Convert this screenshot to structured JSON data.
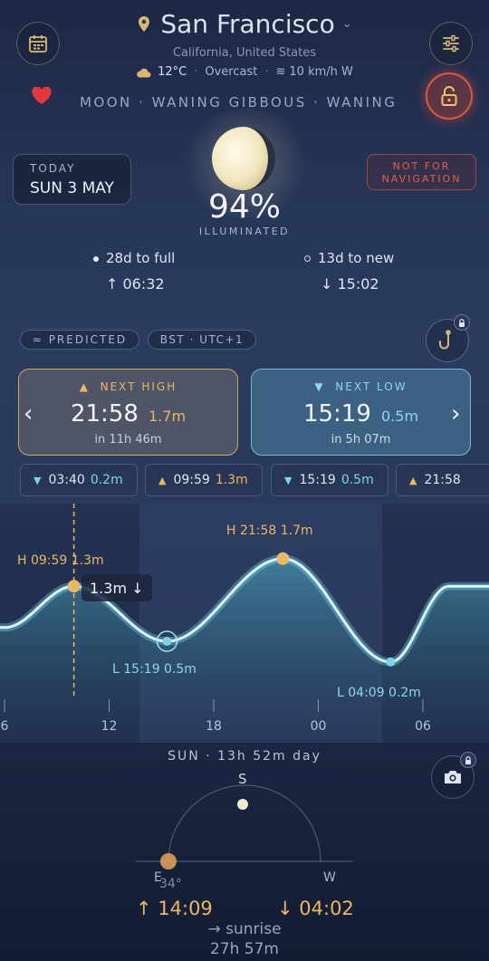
{
  "header": {
    "city": "San Francisco",
    "region": "California, United States",
    "temperature": "12°C",
    "weather": "Overcast",
    "wind": "10 km/h W",
    "phase_line": "MOON · WANING GIBBOUS · WANING"
  },
  "date_card": {
    "label": "TODAY",
    "date": "SUN 3 MAY"
  },
  "warning": {
    "line1": "NOT FOR",
    "line2": "NAVIGATION"
  },
  "moon": {
    "illumination_percent": "94%",
    "illuminated_label": "ILLUMINATED",
    "to_full": "28d to full",
    "to_new": "13d to new",
    "rise": "↑ 06:32",
    "set": "↓ 15:02"
  },
  "tide": {
    "predicted_label": "≈ PREDICTED",
    "timezone_label": "BST · UTC+1",
    "next_high": {
      "label": "NEXT HIGH",
      "time": "21:58",
      "height": "1.7m",
      "eta": "in 11h 46m"
    },
    "next_low": {
      "label": "NEXT LOW",
      "time": "15:19",
      "height": "0.5m",
      "eta": "in 5h 07m"
    },
    "chips": [
      {
        "type": "low",
        "time": "03:40",
        "height": "0.2m"
      },
      {
        "type": "high",
        "time": "09:59",
        "height": "1.3m"
      },
      {
        "type": "low",
        "time": "15:19",
        "height": "0.5m"
      },
      {
        "type": "high",
        "time": "21:58",
        "height": ""
      }
    ],
    "chart_labels": {
      "high1": "H 09:59 1.3m",
      "high2": "H 21:58 1.7m",
      "low1": "L 15:19 0.5m",
      "low2": "L 04:09 0.2m",
      "current": "1.3m ↓"
    },
    "axis_ticks": [
      "6",
      "12",
      "18",
      "00",
      "06"
    ]
  },
  "chart_data": {
    "type": "line",
    "x": [
      6,
      9.98,
      15.32,
      21.97,
      28.15,
      31.5
    ],
    "y": [
      0.7,
      1.3,
      0.5,
      1.7,
      0.2,
      1.3
    ],
    "xticks": [
      "6",
      "12",
      "18",
      "00",
      "06"
    ],
    "markers": [
      {
        "label": "H 09:59 1.3m",
        "x": 9.98,
        "y": 1.3
      },
      {
        "label": "L 15:19 0.5m",
        "x": 15.32,
        "y": 0.5
      },
      {
        "label": "H 21:58 1.7m",
        "x": 21.97,
        "y": 1.7
      },
      {
        "label": "L 04:09 0.2m",
        "x": 28.15,
        "y": 0.2
      }
    ],
    "current": {
      "x": 9.98,
      "y": 1.3
    }
  },
  "sun": {
    "title": "SUN · 13h 52m day",
    "south": "S",
    "east": "E",
    "west": "W",
    "angle": "34°",
    "rise": "↑ 14:09",
    "set": "↓ 04:02",
    "next_label": "→ sunrise",
    "next_in": "27h 57m"
  }
}
